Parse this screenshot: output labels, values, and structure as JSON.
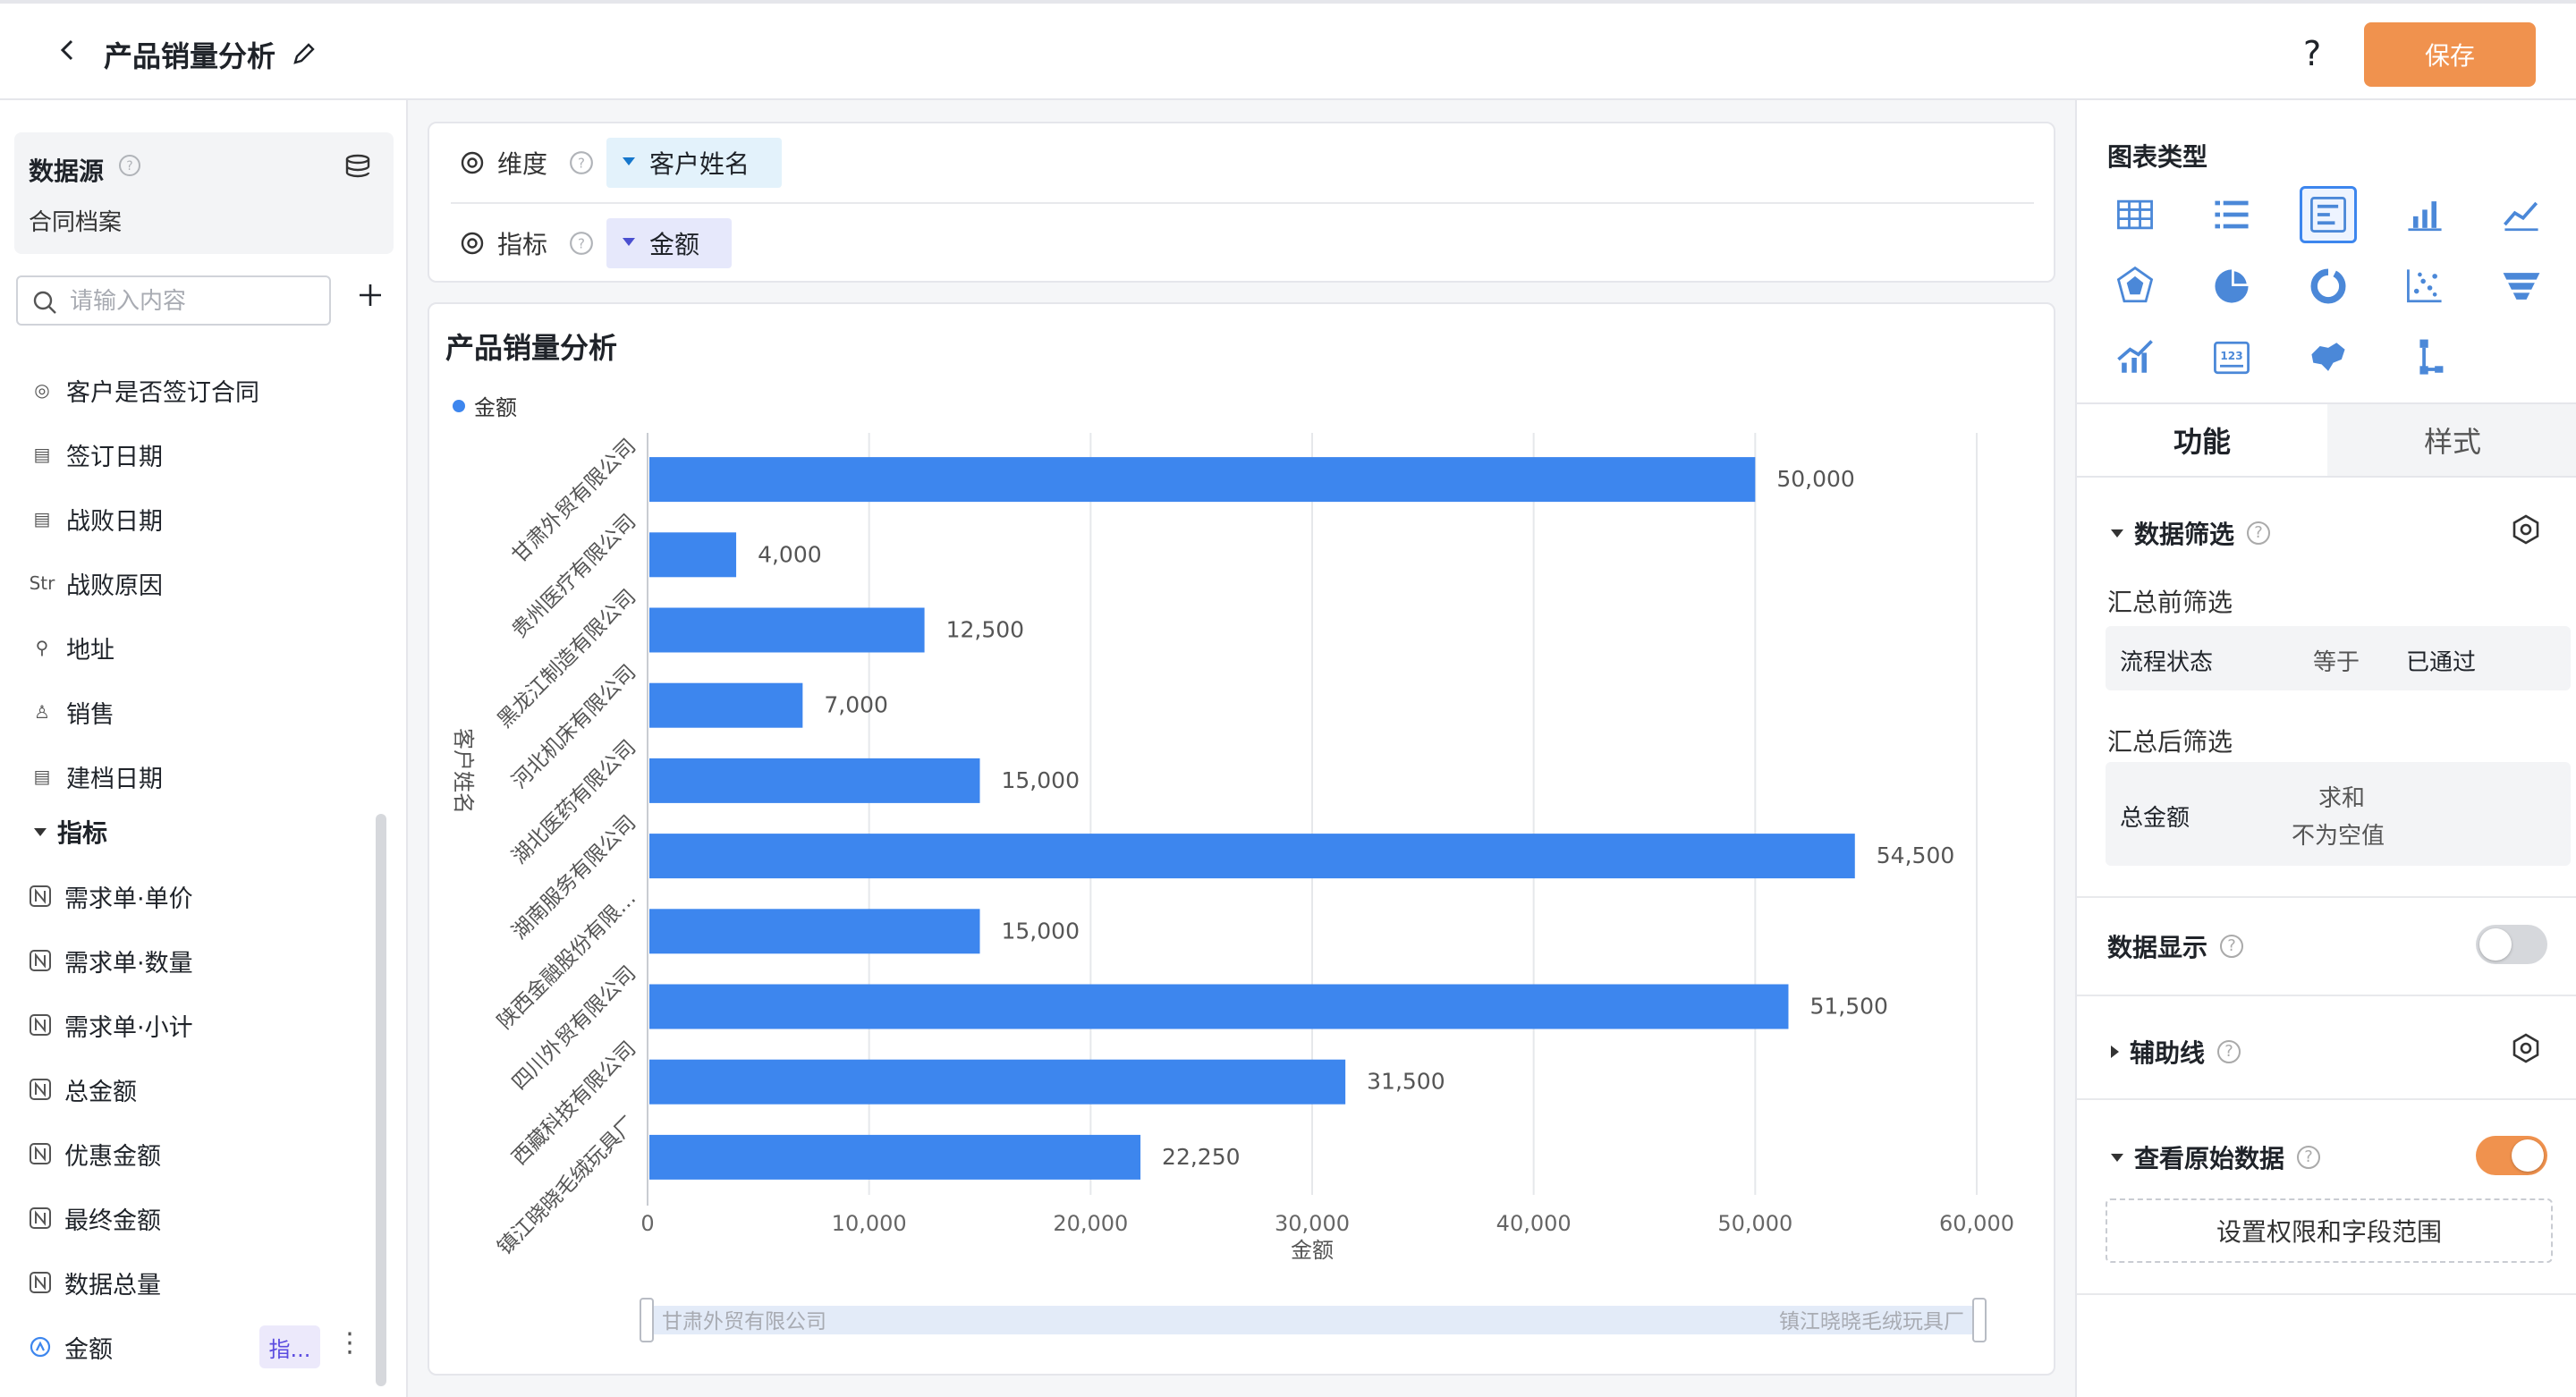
{
  "header": {
    "title": "产品销量分析",
    "help": "?",
    "save_label": "保存"
  },
  "sidebar": {
    "datasource_label": "数据源",
    "datasource_name": "合同档案",
    "search_placeholder": "请输入内容",
    "dimension_fields": [
      {
        "icon": "◎",
        "icon_name": "radio-icon",
        "label": "客户是否签订合同"
      },
      {
        "icon": "▤",
        "icon_name": "date-icon",
        "label": "签订日期"
      },
      {
        "icon": "▤",
        "icon_name": "date-icon",
        "label": "战败日期"
      },
      {
        "icon": "Str",
        "icon_name": "text-icon",
        "label": "战败原因"
      },
      {
        "icon": "⚲",
        "icon_name": "location-icon",
        "label": "地址"
      },
      {
        "icon": "♙",
        "icon_name": "user-icon",
        "label": "销售"
      },
      {
        "icon": "▤",
        "icon_name": "date-icon",
        "label": "建档日期"
      }
    ],
    "metric_group_label": "指标",
    "metric_fields": [
      {
        "label": "需求单·单价"
      },
      {
        "label": "需求单·数量"
      },
      {
        "label": "需求单·小计"
      },
      {
        "label": "总金额"
      },
      {
        "label": "优惠金额"
      },
      {
        "label": "最终金额"
      },
      {
        "label": "数据总量"
      },
      {
        "label": "金额"
      }
    ],
    "metric_tag": "指...",
    "more": "⋮"
  },
  "config": {
    "dimension_label": "维度",
    "dimension_value": "客户姓名",
    "metric_label": "指标",
    "metric_value": "金额"
  },
  "chart_data": {
    "type": "bar",
    "orientation": "horizontal",
    "title": "产品销量分析",
    "xlabel": "金额",
    "ylabel": "客户姓名",
    "categories": [
      "甘肃外贸有限公司",
      "贵州医疗有限公司",
      "黑龙江制造有限公司",
      "河北机床有限公司",
      "湖北医药有限公司",
      "湖南服务有限公司",
      "陕西金融股份有限…",
      "四川外贸有限公司",
      "西藏科技有限公司",
      "镇江晓晓毛绒玩具厂"
    ],
    "series": [
      {
        "name": "金额",
        "values": [
          50000,
          4000,
          12500,
          7000,
          15000,
          54500,
          15000,
          51500,
          31500,
          22250
        ]
      }
    ],
    "value_labels": [
      "50,000",
      "4,000",
      "12,500",
      "7,000",
      "15,000",
      "54,500",
      "15,000",
      "51,500",
      "31,500",
      "22,250"
    ],
    "xlim": [
      0,
      60000
    ],
    "xticks": [
      "0",
      "10,000",
      "20,000",
      "30,000",
      "40,000",
      "50,000",
      "60,000"
    ],
    "grid": true,
    "legend": "top-left",
    "color": "#3d86ee",
    "zoom_start_label": "甘肃外贸有限公司",
    "zoom_end_label": "镇江晓晓毛绒玩具厂"
  },
  "panel": {
    "chart_type_label": "图表类型",
    "chart_types": [
      "table-icon",
      "list-icon",
      "horizontal-bar-icon",
      "bar-chart-icon",
      "line-chart-icon",
      "radar-icon",
      "pie-icon",
      "donut-icon",
      "scatter-icon",
      "funnel-icon",
      "combo-icon",
      "number-card-icon",
      "map-icon",
      "tree-icon"
    ],
    "selected_chart_type": "horizontal-bar-icon",
    "tab_function": "功能",
    "tab_style": "样式",
    "filter_section": "数据筛选",
    "pre_filter_label": "汇总前筛选",
    "pre_filter": {
      "field": "流程状态",
      "op": "等于",
      "value": "已通过"
    },
    "post_filter_label": "汇总后筛选",
    "post_filter": {
      "field": "总金额",
      "agg": "求和",
      "cond": "不为空值"
    },
    "display_label": "数据显示",
    "display_on": false,
    "aux_label": "辅助线",
    "raw_label": "查看原始数据",
    "raw_on": true,
    "perm_button": "设置权限和字段范围",
    "accent": "#f0924e"
  }
}
